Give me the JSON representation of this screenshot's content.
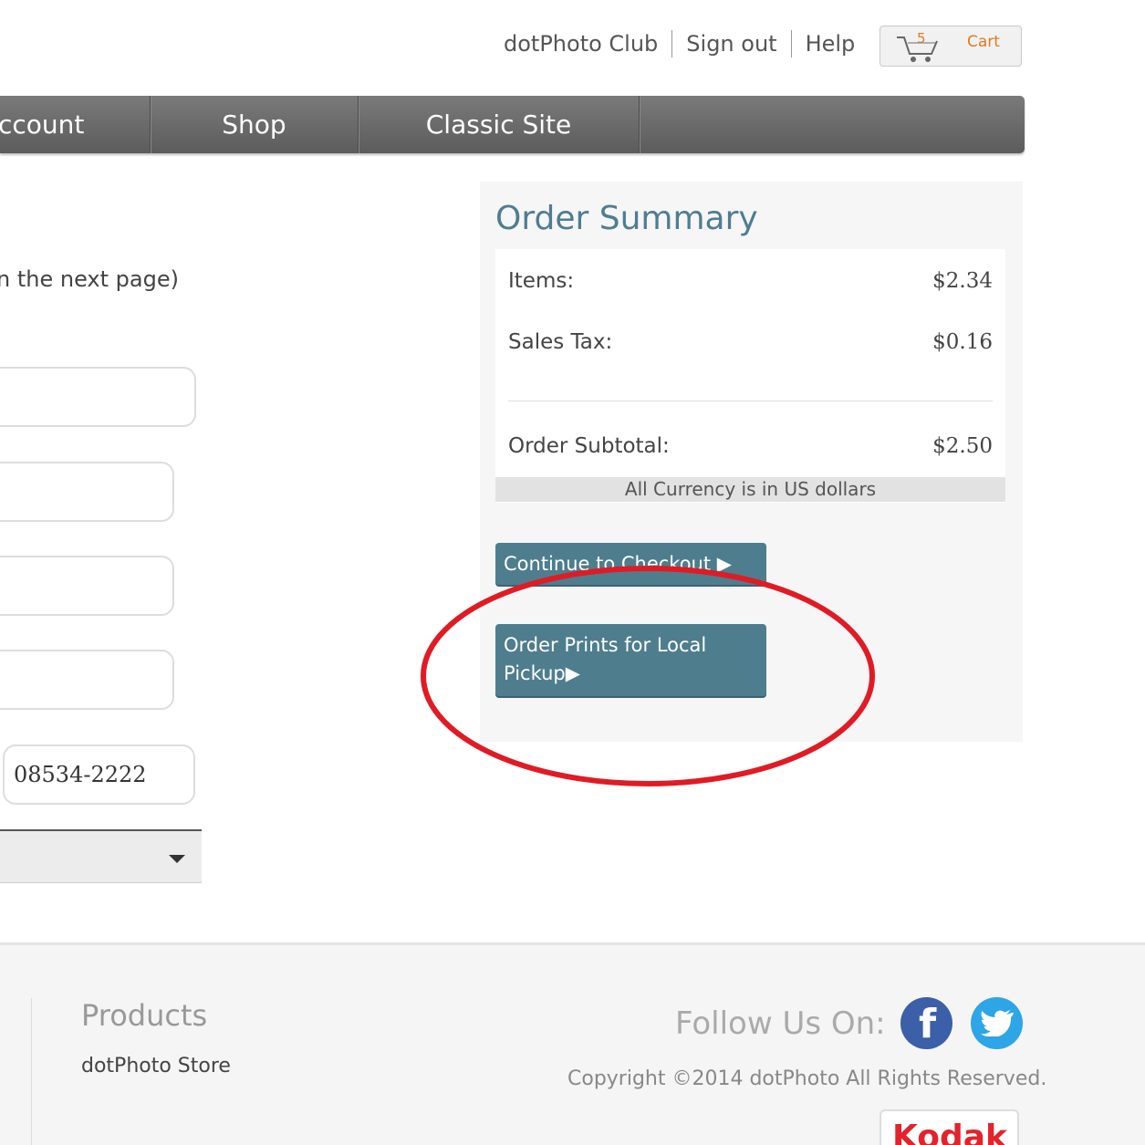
{
  "header": {
    "links": [
      "dotPhoto Club",
      "Sign out",
      "Help"
    ],
    "cart": {
      "count": "5",
      "label": "Cart",
      "icon": "cart-icon",
      "accent": "#e07a1f"
    }
  },
  "nav": {
    "items": [
      "Account",
      "Shop",
      "Classic Site"
    ],
    "partial_first_label": "ccount"
  },
  "form": {
    "hint": "n the next page)",
    "fields": [
      "",
      "",
      "",
      ""
    ],
    "zip_value": "08534-2222",
    "select_value": ""
  },
  "summary": {
    "title": "Order Summary",
    "rows": [
      {
        "label": "Items:",
        "value": "$2.34"
      },
      {
        "label": "Sales Tax:",
        "value": "$0.16"
      }
    ],
    "subtotal": {
      "label": "Order Subtotal:",
      "value": "$2.50"
    },
    "currency_note": "All Currency is in US dollars",
    "checkout_button": "Continue to Checkout ▶",
    "local_pickup_button_line1": "Order Prints for Local",
    "local_pickup_button_line2": "Pickup▶",
    "button_color": "#4e7e8e",
    "annotation_color": "#e01b24"
  },
  "footer": {
    "products_heading": "Products",
    "store_link": "dotPhoto Store",
    "follow": "Follow Us On:",
    "facebook_glyph": "f",
    "copyright": "Copyright ©2014 dotPhoto All Rights Reserved.",
    "partner_logo": "Kodak"
  }
}
